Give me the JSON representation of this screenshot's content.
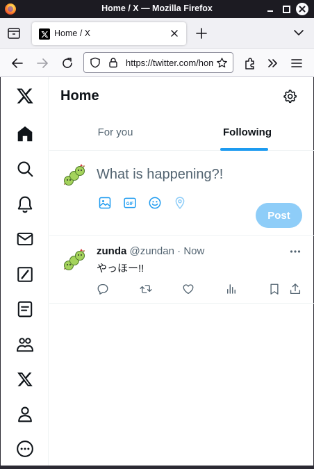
{
  "window": {
    "title": "Home / X — Mozilla Firefox"
  },
  "browser": {
    "tab": {
      "label": "Home / X"
    },
    "url": "https://twitter.com/home"
  },
  "sidebar": {
    "items": [
      {
        "icon": "x-logo-icon"
      },
      {
        "icon": "home-icon"
      },
      {
        "icon": "search-icon"
      },
      {
        "icon": "bell-icon"
      },
      {
        "icon": "mail-icon"
      },
      {
        "icon": "grok-icon"
      },
      {
        "icon": "lists-icon"
      },
      {
        "icon": "communities-icon"
      },
      {
        "icon": "premium-x-icon"
      },
      {
        "icon": "profile-icon"
      },
      {
        "icon": "more-icon"
      }
    ]
  },
  "header": {
    "title": "Home"
  },
  "feed_tabs": [
    {
      "label": "For you",
      "active": false
    },
    {
      "label": "Following",
      "active": true
    }
  ],
  "composer": {
    "placeholder": "What is happening?!",
    "tools": [
      "image-icon",
      "gif-icon",
      "emoji-icon",
      "location-icon"
    ],
    "post_label": "Post"
  },
  "tweet": {
    "name": "zunda",
    "handle": "@zundan",
    "separator": "·",
    "time": "Now",
    "text": "やっほー!!",
    "actions": [
      "reply-icon",
      "retweet-icon",
      "like-icon",
      "views-icon",
      "bookmark-icon",
      "share-icon"
    ]
  },
  "colors": {
    "accent": "#1d9bf0",
    "post_button_disabled": "#8ecdf8",
    "text_primary": "#0f1419",
    "text_secondary": "#536471"
  }
}
